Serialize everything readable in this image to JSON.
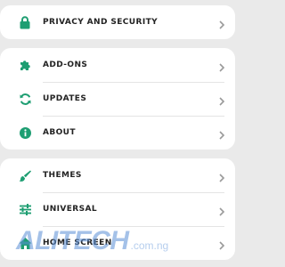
{
  "groups": [
    {
      "items": [
        {
          "label": "Privacy and security",
          "icon": "lock-icon"
        }
      ]
    },
    {
      "items": [
        {
          "label": "Add-ons",
          "icon": "puzzle-icon"
        },
        {
          "label": "Updates",
          "icon": "refresh-icon"
        },
        {
          "label": "About",
          "icon": "info-icon"
        }
      ]
    },
    {
      "items": [
        {
          "label": "Themes",
          "icon": "brush-icon"
        },
        {
          "label": "Universal",
          "icon": "sliders-icon"
        },
        {
          "label": "Home screen",
          "icon": "home-icon"
        }
      ]
    }
  ],
  "watermark": {
    "main": "ALITECH",
    "sub": ".com.ng"
  },
  "colors": {
    "accent": "#1e9e72",
    "background": "#eaeaea",
    "card": "#ffffff",
    "text": "#222222",
    "chevron": "#9a9a9a"
  }
}
